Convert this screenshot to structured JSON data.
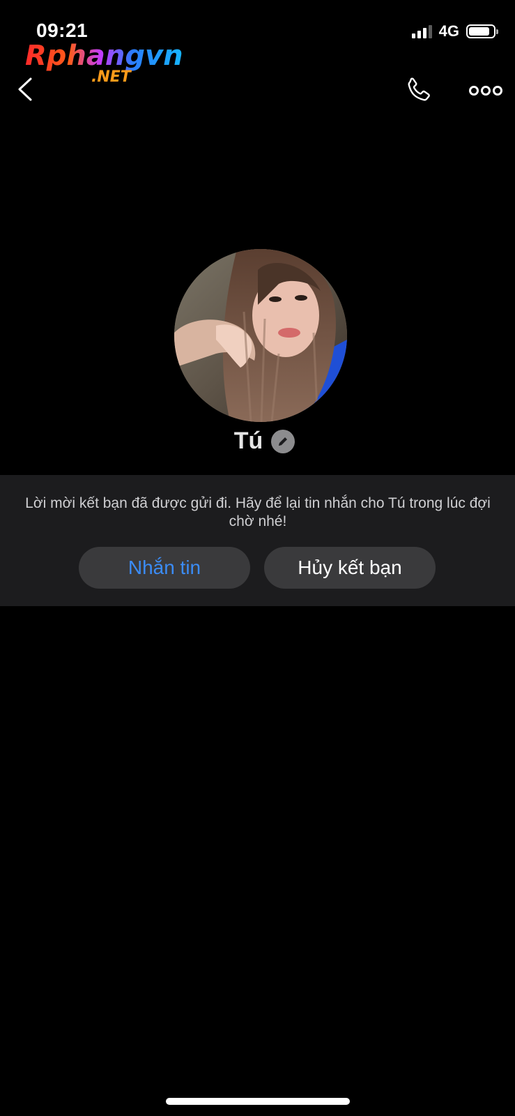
{
  "status_bar": {
    "time": "09:21",
    "network": "4G",
    "battery_level": 0.86
  },
  "watermark": {
    "brand": "Rphangvn",
    "suffix": ".NET"
  },
  "header": {
    "back_icon": "chevron-left-icon",
    "call_icon": "phone-icon",
    "more_icon": "more-horizontal-icon"
  },
  "profile": {
    "name": "Tú",
    "edit_icon": "pencil-icon"
  },
  "friend_request": {
    "message": "Lời mời kết bạn đã được gửi đi. Hãy để lại tin nhắn cho Tú trong lúc đợi chờ nhé!",
    "message_button": "Nhắn tin",
    "cancel_button": "Hủy kết bạn"
  },
  "colors": {
    "background": "#000000",
    "panel": "#1c1c1e",
    "button": "#3a3a3c",
    "accent": "#3b8cf6"
  }
}
